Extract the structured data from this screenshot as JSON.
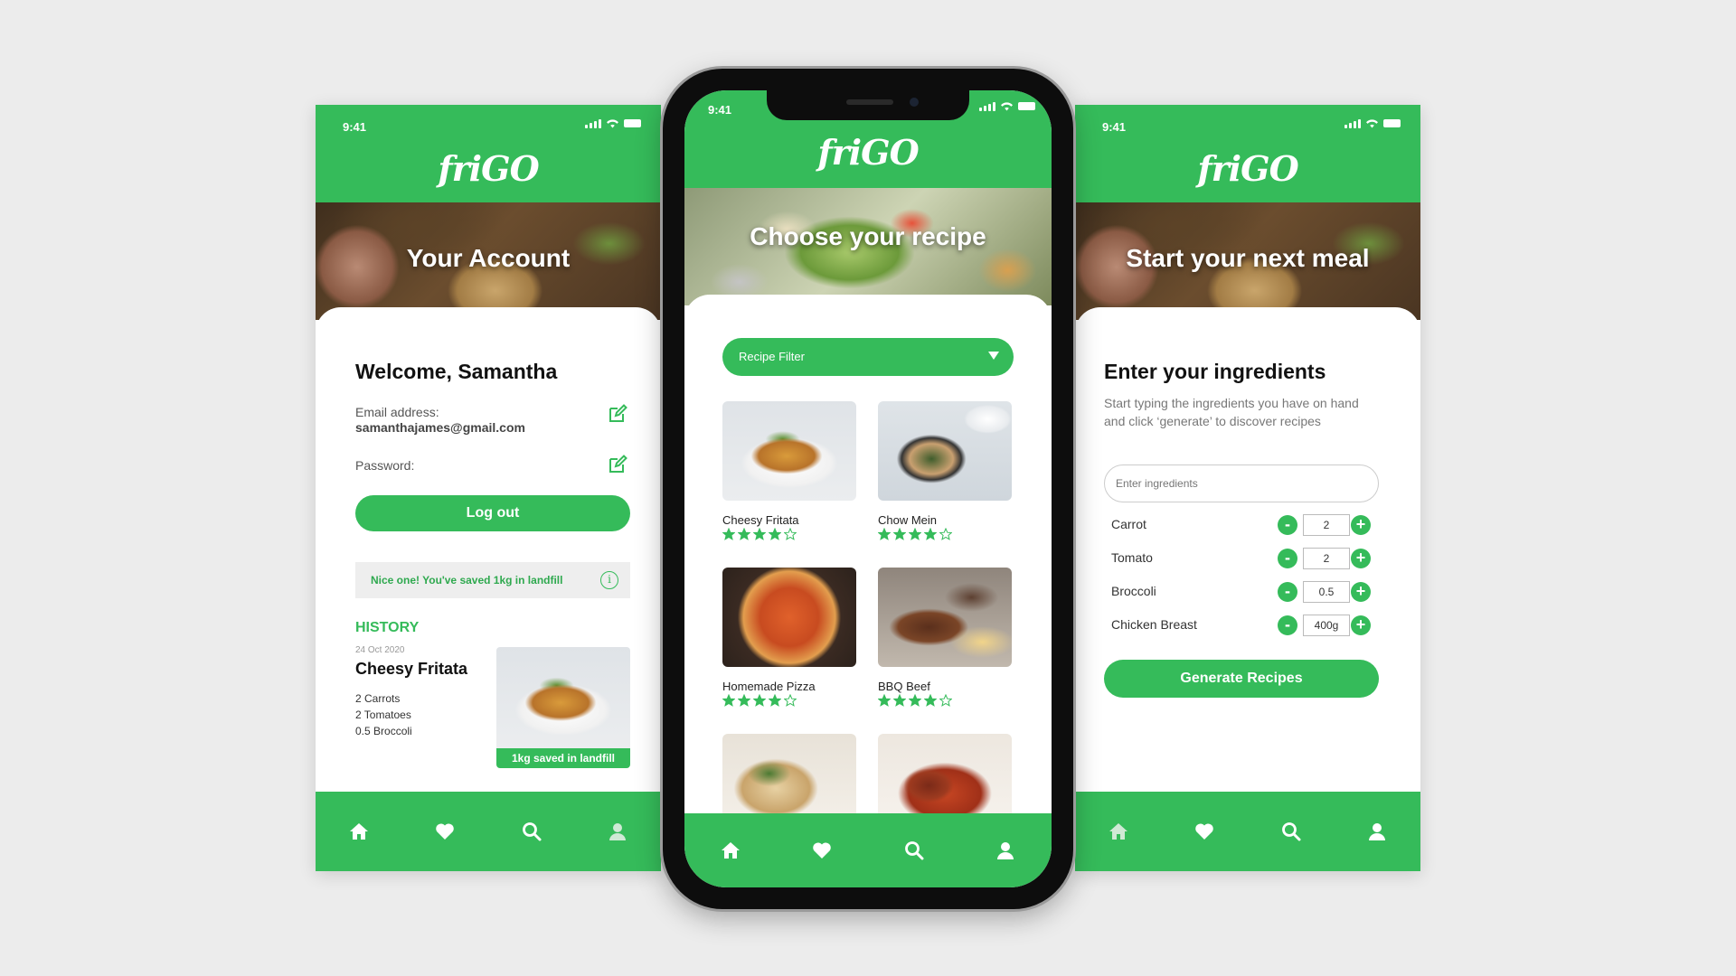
{
  "status_time": "9:41",
  "brand": "friGO",
  "left_screen": {
    "hero_title": "Your Account",
    "welcome": "Welcome, Samantha",
    "email_label": "Email address:",
    "email_value": "samanthajames@gmail.com",
    "password_label": "Password:",
    "logout_label": "Log out",
    "saved_banner": "Nice one! You've saved 1kg in landfill",
    "info_glyph": "i",
    "history_heading": "HISTORY",
    "history": {
      "date": "24 Oct 2020",
      "title": "Cheesy Fritata",
      "ingredients": [
        "2 Carrots",
        "2 Tomatoes",
        "0.5 Broccoli"
      ],
      "badge": "1kg saved in landfill"
    }
  },
  "center_screen": {
    "hero_title": "Choose your recipe",
    "filter_label": "Recipe Filter",
    "recipes": [
      {
        "name": "Cheesy Fritata",
        "rating": 4,
        "image": "fritata"
      },
      {
        "name": "Chow Mein",
        "rating": 4,
        "image": "chowmein"
      },
      {
        "name": "Homemade Pizza",
        "rating": 4,
        "image": "pizza"
      },
      {
        "name": "BBQ Beef",
        "rating": 4,
        "image": "bbq"
      },
      {
        "name": "",
        "rating": null,
        "image": "pasta"
      },
      {
        "name": "",
        "rating": null,
        "image": "meatball"
      }
    ]
  },
  "right_screen": {
    "hero_title": "Start your next meal",
    "heading": "Enter your ingredients",
    "description": "Start typing the ingredients you have on hand and click ‘generate’ to discover recipes",
    "input_placeholder": "Enter ingredients",
    "ingredients": [
      {
        "name": "Carrot",
        "qty": "2"
      },
      {
        "name": "Tomato",
        "qty": "2"
      },
      {
        "name": "Broccoli",
        "qty": "0.5"
      },
      {
        "name": "Chicken Breast",
        "qty": "400g"
      }
    ],
    "minus_glyph": "-",
    "plus_glyph": "+",
    "generate_label": "Generate Recipes"
  },
  "nav_icons": [
    "home-icon",
    "heart-icon",
    "search-icon",
    "profile-icon"
  ],
  "colors": {
    "accent": "#35bb5a",
    "background": "#ececec"
  }
}
